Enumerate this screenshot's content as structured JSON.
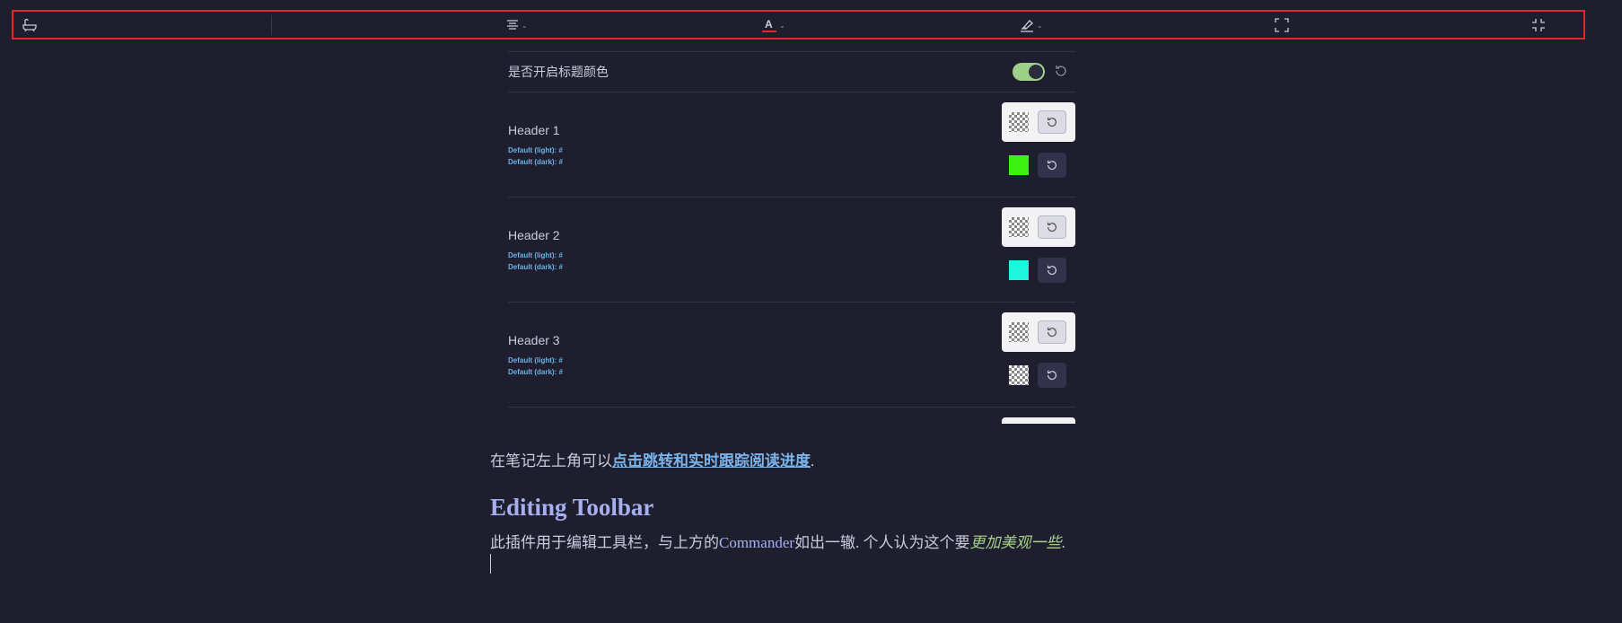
{
  "toolbar": {
    "buttons": [
      {
        "name": "bathtub-icon"
      },
      {
        "name": "align-center-icon",
        "has_dropdown": true
      },
      {
        "name": "font-color-icon",
        "has_dropdown": true,
        "accent": "#e02a2a"
      },
      {
        "name": "highlighter-icon",
        "has_dropdown": true,
        "accent": "#e02a2a"
      },
      {
        "name": "fullscreen-icon"
      },
      {
        "name": "exit-fullscreen-icon"
      }
    ],
    "caret": "⌄",
    "border_color": "#e02a2a"
  },
  "settings": {
    "toggle_label": "是否开启标题颜色",
    "toggle_on": true,
    "headers": [
      {
        "label": "Header 1",
        "default_light": "Default (light): #",
        "default_dark": "Default (dark): #",
        "dark_color": "#3ef012",
        "dark_transparent": false
      },
      {
        "label": "Header 2",
        "default_light": "Default (light): #",
        "default_dark": "Default (dark): #",
        "dark_color": "#1ef5dd",
        "dark_transparent": false
      },
      {
        "label": "Header 3",
        "default_light": "Default (light): #",
        "default_dark": "Default (dark): #",
        "dark_color": "",
        "dark_transparent": true
      }
    ]
  },
  "document": {
    "line1_prefix": "在笔记左上角可以",
    "line1_link": "点击跳转和实时跟踪阅读进度",
    "line1_suffix": ".",
    "heading": "Editing Toolbar",
    "line2_prefix": "此插件用于编辑工具栏，与上方的",
    "line2_link": "Commander",
    "line2_middle": "如出一辙. 个人认为这个要",
    "line2_italic": "更加美观一些",
    "line2_suffix": "."
  }
}
